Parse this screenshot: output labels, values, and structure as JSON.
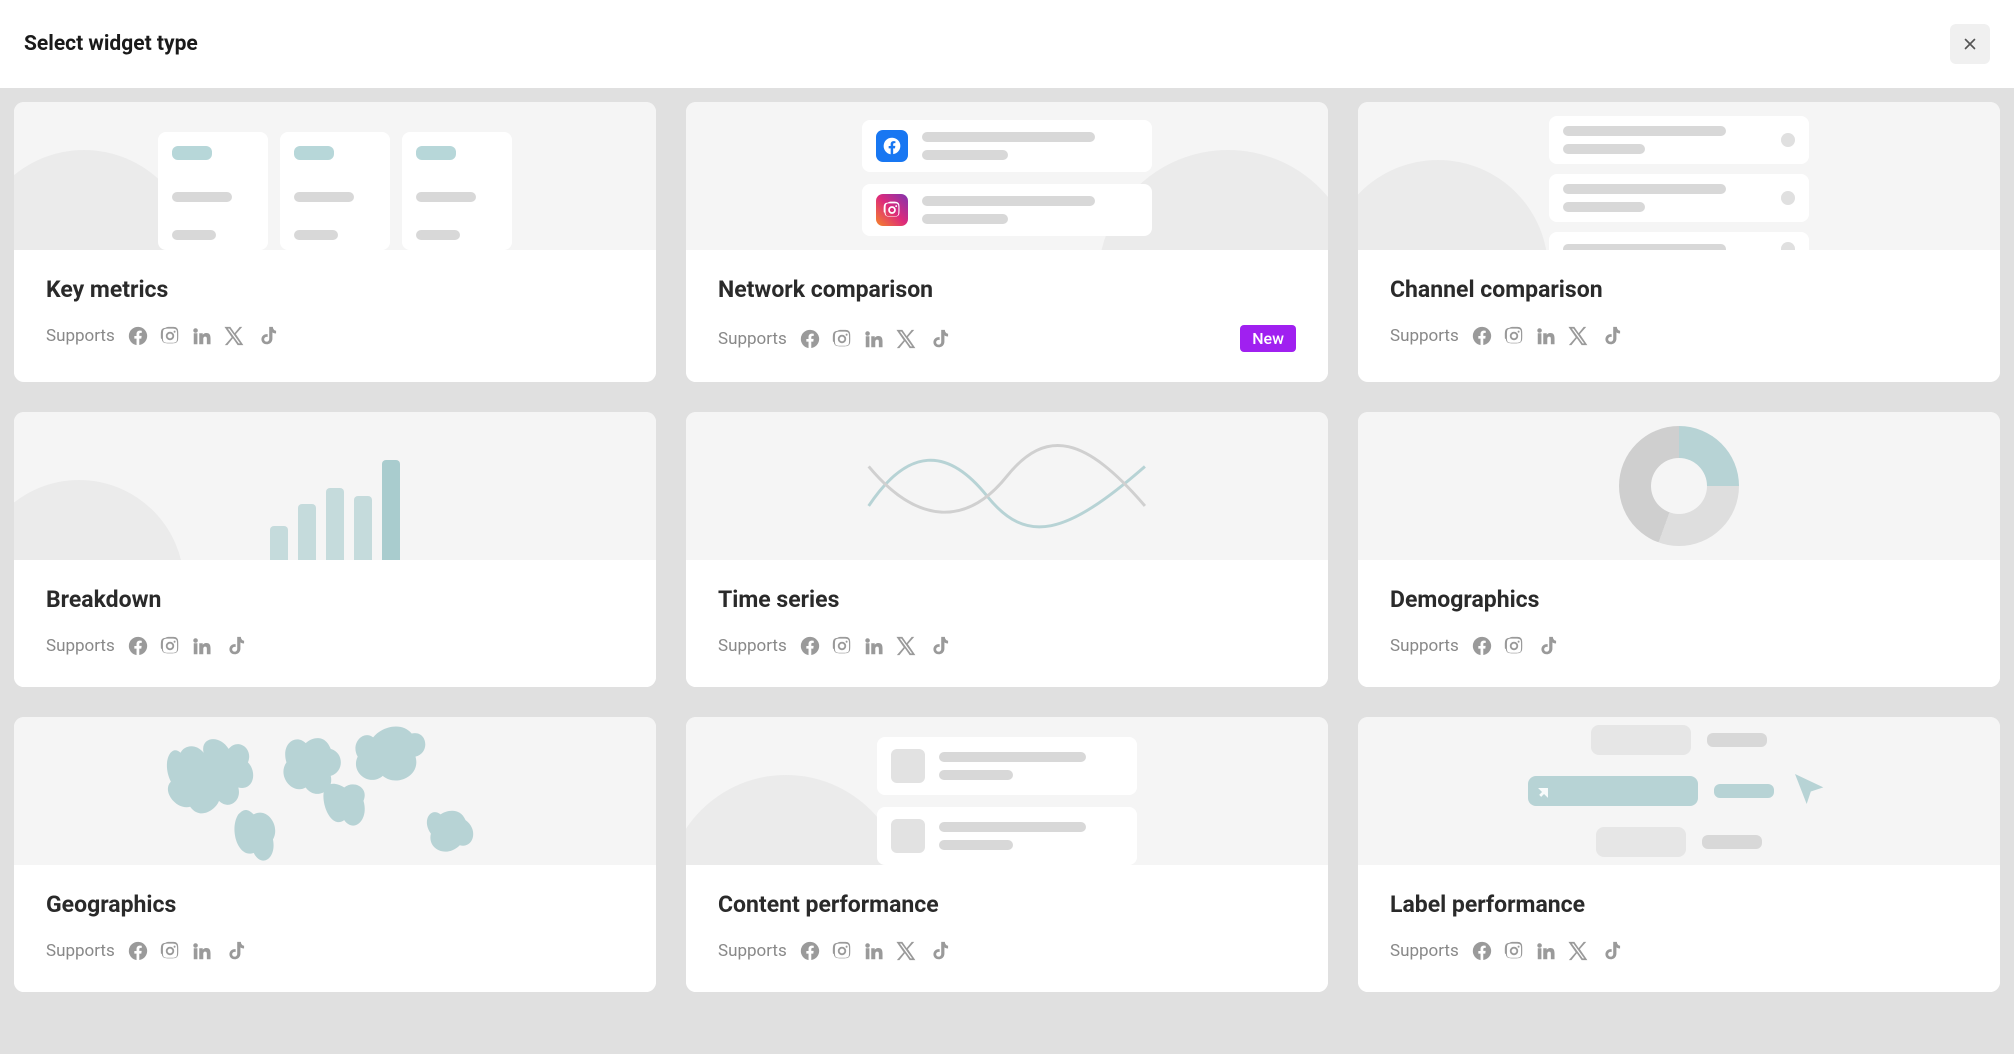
{
  "header": {
    "title": "Select widget type"
  },
  "supports_label": "Supports",
  "badge_new": "New",
  "widgets": [
    {
      "title": "Key metrics",
      "icons": [
        "facebook",
        "instagram",
        "linkedin",
        "x",
        "tiktok"
      ],
      "badge": null
    },
    {
      "title": "Network comparison",
      "icons": [
        "facebook",
        "instagram",
        "linkedin",
        "x",
        "tiktok"
      ],
      "badge": "new"
    },
    {
      "title": "Channel comparison",
      "icons": [
        "facebook",
        "instagram",
        "linkedin",
        "x",
        "tiktok"
      ],
      "badge": null
    },
    {
      "title": "Breakdown",
      "icons": [
        "facebook",
        "instagram",
        "linkedin",
        "tiktok"
      ],
      "badge": null
    },
    {
      "title": "Time series",
      "icons": [
        "facebook",
        "instagram",
        "linkedin",
        "x",
        "tiktok"
      ],
      "badge": null
    },
    {
      "title": "Demographics",
      "icons": [
        "facebook",
        "instagram",
        "tiktok"
      ],
      "badge": null
    },
    {
      "title": "Geographics",
      "icons": [
        "facebook",
        "instagram",
        "linkedin",
        "tiktok"
      ],
      "badge": null
    },
    {
      "title": "Content performance",
      "icons": [
        "facebook",
        "instagram",
        "linkedin",
        "x",
        "tiktok"
      ],
      "badge": null
    },
    {
      "title": "Label performance",
      "icons": [
        "facebook",
        "instagram",
        "linkedin",
        "x",
        "tiktok"
      ],
      "badge": null
    }
  ]
}
